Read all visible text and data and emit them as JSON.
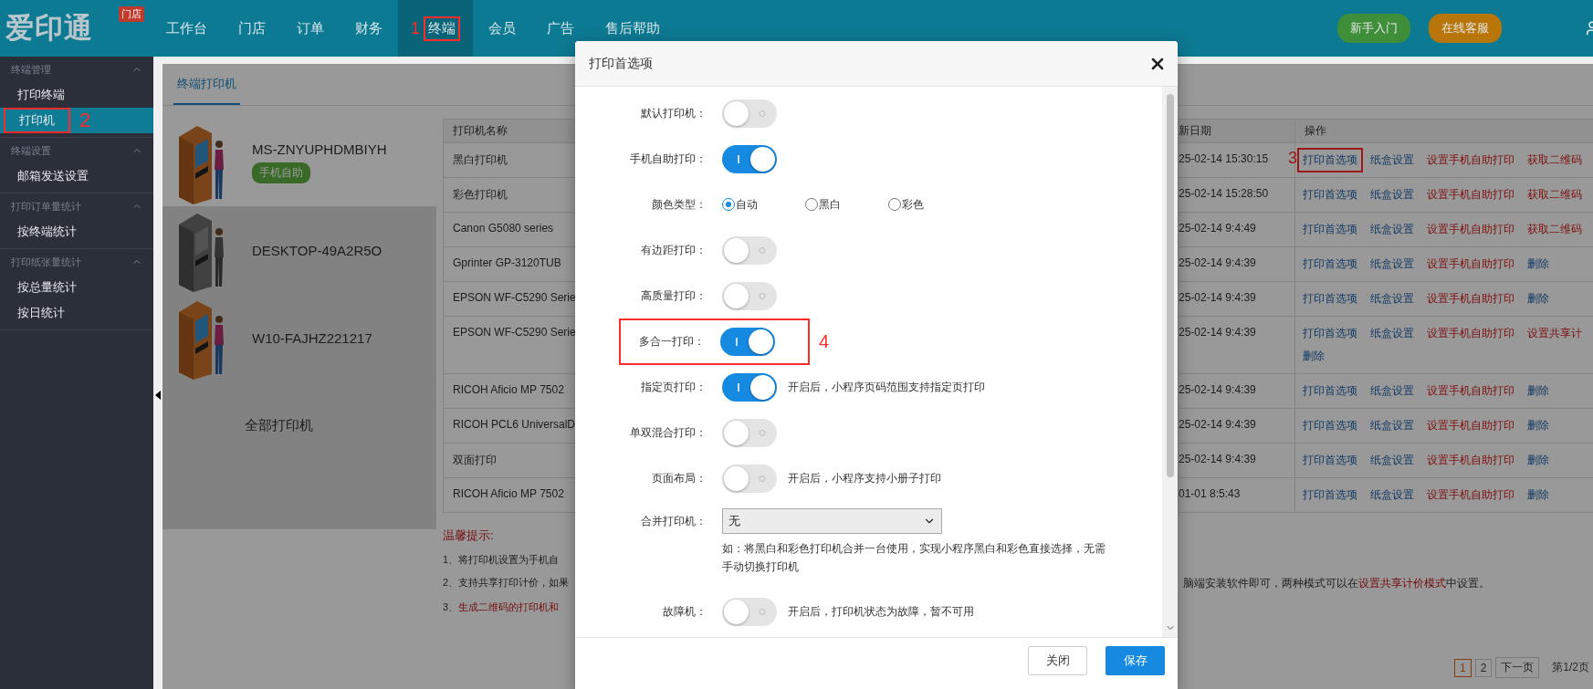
{
  "brand": {
    "logo": "爱印通",
    "badge": "门店"
  },
  "nav": [
    {
      "label": "工作台",
      "selected": false
    },
    {
      "label": "门店",
      "selected": false
    },
    {
      "label": "订单",
      "selected": false
    },
    {
      "label": "财务",
      "selected": false
    },
    {
      "label": "终端",
      "selected": true,
      "annotation": "1"
    },
    {
      "label": "会员",
      "selected": false
    },
    {
      "label": "广告",
      "selected": false
    },
    {
      "label": "售后帮助",
      "selected": false
    }
  ],
  "header_buttons": [
    {
      "label": "新手入门",
      "color": "#3f8f3a"
    },
    {
      "label": "在线客服",
      "color": "#b8760a"
    }
  ],
  "sidebar": [
    {
      "title": "终端管理",
      "expanded": true,
      "items": [
        {
          "label": "打印终端",
          "selected": false
        },
        {
          "label": "打印机",
          "selected": true,
          "annotation": "2"
        }
      ]
    },
    {
      "title": "终端设置",
      "expanded": true,
      "items": [
        {
          "label": "邮箱发送设置",
          "selected": false
        }
      ]
    },
    {
      "title": "打印订单量统计",
      "expanded": true,
      "items": [
        {
          "label": "按终端统计",
          "selected": false
        }
      ]
    },
    {
      "title": "打印纸张量统计",
      "expanded": true,
      "items": [
        {
          "label": "按总量统计",
          "selected": false
        },
        {
          "label": "按日统计",
          "selected": false
        }
      ]
    }
  ],
  "tabs": [
    {
      "label": "终端打印机",
      "selected": true
    }
  ],
  "terminals": [
    {
      "kind": "terminal",
      "name": "MS-ZNYUPHDMBIYH",
      "badge": "手机自助",
      "online": true,
      "selected": true
    },
    {
      "kind": "terminal",
      "name": "DESKTOP-49A2R5O",
      "online": false,
      "selected": false
    },
    {
      "kind": "terminal",
      "name": "W10-FAJHZ221217",
      "online": true,
      "selected": false
    },
    {
      "kind": "all",
      "name": "全部打印机",
      "selected": false
    }
  ],
  "table": {
    "columns": [
      "打印机名称",
      "新日期",
      "操作"
    ],
    "rows": [
      {
        "name": "黑白打印机",
        "date": "25-02-14 15:30:15",
        "actions": [
          {
            "label": "打印首选项",
            "kind": "primary",
            "annotation": "3"
          },
          {
            "label": "纸盒设置",
            "kind": "primary"
          },
          {
            "label": "设置手机自助打印",
            "kind": "danger"
          },
          {
            "label": "获取二维码",
            "kind": "danger"
          }
        ]
      },
      {
        "name": "彩色打印机",
        "date": "25-02-14 15:28:50",
        "actions": [
          {
            "label": "打印首选项",
            "kind": "primary"
          },
          {
            "label": "纸盒设置",
            "kind": "primary"
          },
          {
            "label": "设置手机自助打印",
            "kind": "danger"
          },
          {
            "label": "获取二维码",
            "kind": "danger"
          }
        ]
      },
      {
        "name": "Canon G5080 series",
        "date": "25-02-14 9:4:49",
        "actions": [
          {
            "label": "打印首选项",
            "kind": "primary"
          },
          {
            "label": "纸盒设置",
            "kind": "primary"
          },
          {
            "label": "设置手机自助打印",
            "kind": "danger"
          },
          {
            "label": "获取二维码",
            "kind": "danger"
          }
        ]
      },
      {
        "name": "Gprinter GP-3120TUB",
        "date": "25-02-14 9:4:39",
        "actions": [
          {
            "label": "打印首选项",
            "kind": "primary"
          },
          {
            "label": "纸盒设置",
            "kind": "primary"
          },
          {
            "label": "设置手机自助打印",
            "kind": "danger"
          },
          {
            "label": "删除",
            "kind": "primary"
          }
        ]
      },
      {
        "name": "EPSON WF-C5290 Serie",
        "date": "25-02-14 9:4:39",
        "actions": [
          {
            "label": "打印首选项",
            "kind": "primary"
          },
          {
            "label": "纸盒设置",
            "kind": "primary"
          },
          {
            "label": "设置手机自助打印",
            "kind": "danger"
          },
          {
            "label": "删除",
            "kind": "primary"
          }
        ]
      },
      {
        "name": "EPSON WF-C5290 Serie",
        "date": "25-02-14 9:4:39",
        "actions": [
          {
            "label": "打印首选项",
            "kind": "primary"
          },
          {
            "label": "纸盒设置",
            "kind": "primary"
          },
          {
            "label": "设置手机自助打印",
            "kind": "danger"
          },
          {
            "label": "设置共享计",
            "kind": "danger"
          },
          {
            "label": "删除",
            "kind": "primary"
          }
        ]
      },
      {
        "name": "RICOH Aficio MP 7502",
        "date": "25-02-14 9:4:39",
        "actions": [
          {
            "label": "打印首选项",
            "kind": "primary"
          },
          {
            "label": "纸盒设置",
            "kind": "primary"
          },
          {
            "label": "设置手机自助打印",
            "kind": "danger"
          },
          {
            "label": "删除",
            "kind": "primary"
          }
        ]
      },
      {
        "name": "RICOH PCL6 UniversalD",
        "date": "25-02-14 9:4:39",
        "actions": [
          {
            "label": "打印首选项",
            "kind": "primary"
          },
          {
            "label": "纸盒设置",
            "kind": "primary"
          },
          {
            "label": "设置手机自助打印",
            "kind": "danger"
          },
          {
            "label": "删除",
            "kind": "primary"
          }
        ]
      },
      {
        "name": "双面打印",
        "date": "25-02-14 9:4:39",
        "actions": [
          {
            "label": "打印首选项",
            "kind": "primary"
          },
          {
            "label": "纸盒设置",
            "kind": "primary"
          },
          {
            "label": "设置手机自助打印",
            "kind": "danger"
          },
          {
            "label": "删除",
            "kind": "primary"
          }
        ]
      },
      {
        "name": "RICOH Aficio MP 7502",
        "date": "01-01 8:5:43",
        "actions": [
          {
            "label": "打印首选项",
            "kind": "primary"
          },
          {
            "label": "纸盒设置",
            "kind": "primary"
          },
          {
            "label": "设置手机自助打印",
            "kind": "danger"
          },
          {
            "label": "删除",
            "kind": "primary"
          }
        ]
      }
    ]
  },
  "tips": {
    "title": "温馨提示:",
    "lines": [
      {
        "left": [
          {
            "text": "1、将打印机设置为手机自",
            "kind": "plain"
          }
        ]
      },
      {
        "left": [
          {
            "text": "2、支持共享打印计价，如果",
            "kind": "plain"
          }
        ],
        "right": [
          {
            "text": "脑端安装软件即可，两种模式可以在",
            "kind": "plain"
          },
          {
            "text": "设置共享计价模式",
            "kind": "link"
          },
          {
            "text": "中设置。",
            "kind": "plain"
          }
        ]
      },
      {
        "left": [
          {
            "text": "3、",
            "kind": "plain"
          },
          {
            "text": "生成二维码的打印机和",
            "kind": "highlight"
          }
        ]
      }
    ]
  },
  "pagination": {
    "pages": [
      {
        "label": "1",
        "selected": true
      },
      {
        "label": "2",
        "selected": false
      }
    ],
    "next": "下一页",
    "info": "第1/2页"
  },
  "dialog": {
    "title": "打印首选项",
    "fields": [
      {
        "kind": "switch",
        "label": "默认打印机：",
        "on": false
      },
      {
        "kind": "switch",
        "label": "手机自助打印：",
        "on": true
      },
      {
        "kind": "radio",
        "label": "颜色类型：",
        "options": [
          {
            "label": "自动",
            "selected": true
          },
          {
            "label": "黑白",
            "selected": false
          },
          {
            "label": "彩色",
            "selected": false
          }
        ]
      },
      {
        "kind": "switch",
        "label": "有边距打印：",
        "on": false
      },
      {
        "kind": "switch",
        "label": "高质量打印：",
        "on": false
      },
      {
        "kind": "switch",
        "label": "多合一打印：",
        "on": true,
        "annotation": "4"
      },
      {
        "kind": "switch",
        "label": "指定页打印：",
        "on": true,
        "note": "开启后，小程序页码范围支持指定页打印"
      },
      {
        "kind": "switch",
        "label": "单双混合打印：",
        "on": false
      },
      {
        "kind": "switch",
        "label": "页面布局：",
        "on": false,
        "note": "开启后，小程序支持小册子打印"
      },
      {
        "kind": "select",
        "label": "合并打印机：",
        "value": "无",
        "hint": "如：将黑白和彩色打印机合并一台使用，实现小程序黑白和彩色直接选择，无需手动切换打印机"
      },
      {
        "kind": "switch",
        "label": "故障机：",
        "on": false,
        "note": "开启后，打印机状态为故障，暂不可用"
      }
    ],
    "buttons": [
      {
        "label": "关闭",
        "kind": "secondary"
      },
      {
        "label": "保存",
        "kind": "primary"
      }
    ]
  }
}
